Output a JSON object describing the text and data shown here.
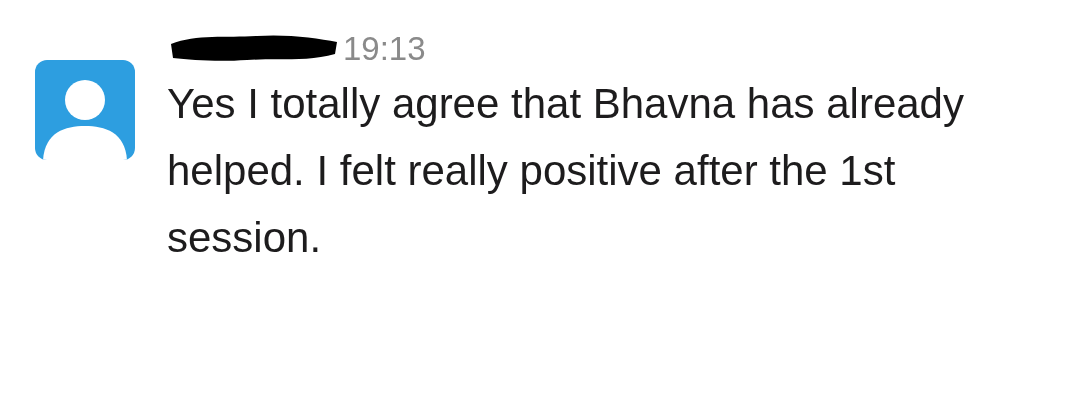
{
  "message": {
    "time": "19:13",
    "text": "Yes I totally agree that Bhavna has already helped. I felt really positive after the 1st session."
  }
}
